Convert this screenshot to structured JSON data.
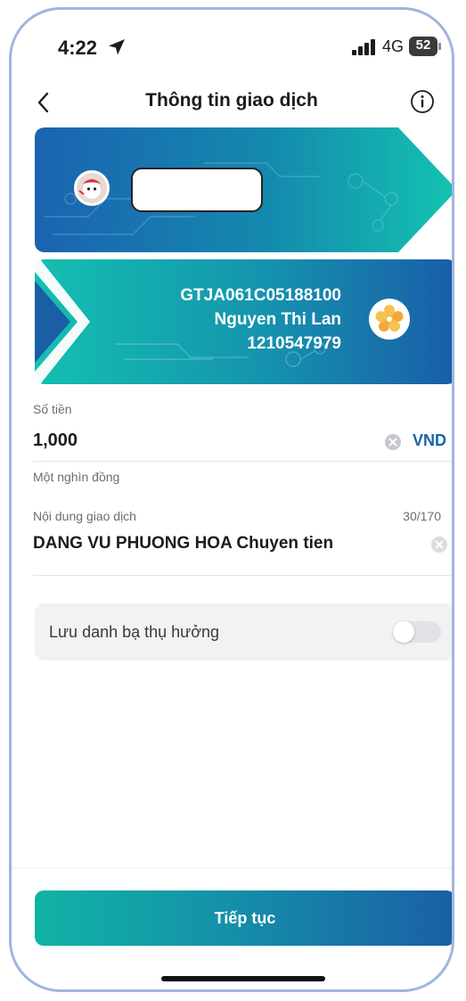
{
  "status_bar": {
    "time": "4:22",
    "network": "4G",
    "battery": "52"
  },
  "header": {
    "title": "Thông tin giao dịch",
    "back_icon": "chevron-left-icon",
    "info_icon": "info-icon"
  },
  "recipient": {
    "account_code": "GTJA061C05188100",
    "name": "Nguyen Thi Lan",
    "account_number": "1210547979"
  },
  "amount": {
    "label": "Số tiền",
    "value": "1,000",
    "currency": "VND",
    "in_words": "Một nghìn đồng"
  },
  "content": {
    "label": "Nội dung giao dịch",
    "counter": "30/170",
    "value": "DANG VU PHUONG HOA Chuyen tien"
  },
  "save_contact": {
    "label": "Lưu danh bạ thụ hưởng",
    "enabled": false
  },
  "actions": {
    "continue_label": "Tiếp tục"
  },
  "colors": {
    "teal": "#11b3a6",
    "blue": "#1a5fa6",
    "currency": "#1565a8"
  }
}
